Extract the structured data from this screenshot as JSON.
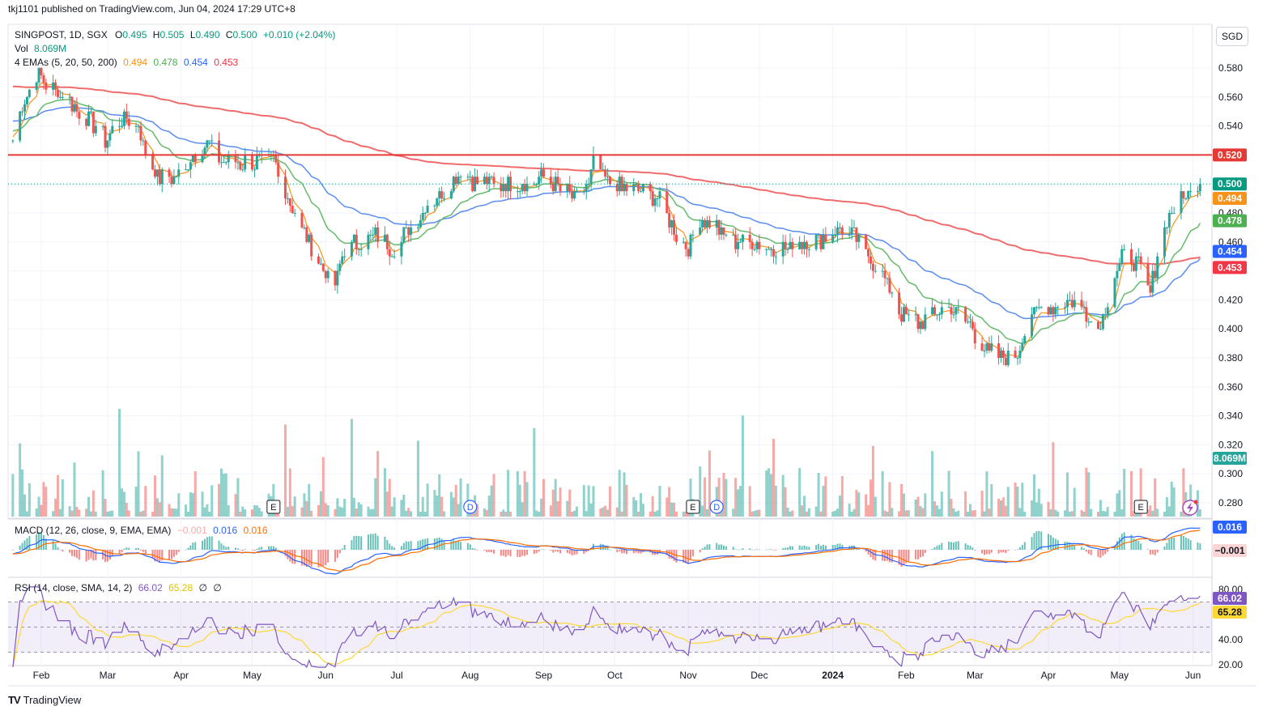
{
  "header": {
    "publish_text": "tkj1101 published on TradingView.com, Jun 04, 2024 17:29 UTC+8"
  },
  "legend": {
    "symbol": "SINGPOST, 1D, SGX",
    "o_label": "O",
    "o": "0.495",
    "h_label": "H",
    "h": "0.505",
    "l_label": "L",
    "l": "0.490",
    "c_label": "C",
    "c": "0.500",
    "change": "+0.010 (+2.04%)",
    "vol_label": "Vol",
    "vol": "8.069M",
    "ema_label": "4 EMAs (5, 20, 50, 200)",
    "ema5": "0.494",
    "ema20": "0.478",
    "ema50": "0.454",
    "ema200": "0.453"
  },
  "macd_legend": {
    "label": "MACD (12, 26, close, 9, EMA, EMA)",
    "hist": "−0.001",
    "macd": "0.016",
    "signal": "0.016"
  },
  "rsi_legend": {
    "label": "RSI (14, close, SMA, 14, 2)",
    "rsi": "66.02",
    "sma": "65.28",
    "u1": "∅",
    "u2": "∅"
  },
  "currency_button": "SGD",
  "brand": {
    "text": "TradingView",
    "logo": "TV"
  },
  "colors": {
    "up": "#26a69a",
    "down": "#ef5350",
    "ema5": "#f7931a",
    "ema20": "#66bb6a",
    "ema50": "#5b8def",
    "ema200": "#f06b6b",
    "resistance": "#e53935",
    "macd": "#2962ff",
    "signal": "#ff6d00",
    "rsi": "#7e57c2",
    "rsi_sma": "#fdd835"
  },
  "price_labels": {
    "resistance": "0.520",
    "last": "0.500",
    "ema5": "0.494",
    "ema20": "0.478",
    "ema50": "0.454",
    "ema200": "0.453",
    "volume": "8.069M",
    "macd": "0.016",
    "macd_hist": "−0.001",
    "rsi": "66.02",
    "rsi_sma": "65.28"
  },
  "event_markers": [
    {
      "label": "E",
      "kind": "earnings",
      "date": "2023-05-10"
    },
    {
      "label": "D",
      "kind": "dividend",
      "date": "2023-08-01"
    },
    {
      "label": "E",
      "kind": "earnings",
      "date": "2023-11-03"
    },
    {
      "label": "D",
      "kind": "dividend",
      "date": "2023-11-13"
    },
    {
      "label": "E",
      "kind": "earnings",
      "date": "2024-05-10"
    }
  ],
  "chart_data": {
    "type": "candlestick",
    "x_axis": {
      "labels": [
        "Feb",
        "Mar",
        "Apr",
        "May",
        "Jun",
        "Jul",
        "Aug",
        "Sep",
        "Oct",
        "Nov",
        "Dec",
        "2024",
        "Feb",
        "Mar",
        "Apr",
        "May",
        "Jun"
      ],
      "dates": [
        "2023-02-01",
        "2023-03-01",
        "2023-04-01",
        "2023-05-01",
        "2023-06-01",
        "2023-07-01",
        "2023-08-01",
        "2023-09-01",
        "2023-10-01",
        "2023-11-01",
        "2023-12-01",
        "2024-01-01",
        "2024-02-01",
        "2024-03-01",
        "2024-04-01",
        "2024-05-01",
        "2024-06-01"
      ]
    },
    "y_axis": {
      "ticks": [
        "0.580",
        "0.560",
        "0.540",
        "0.520",
        "0.500",
        "0.480",
        "0.460",
        "0.440",
        "0.420",
        "0.400",
        "0.380",
        "0.360",
        "0.340",
        "0.320",
        "0.300",
        "0.280"
      ],
      "range": [
        0.27,
        0.59
      ]
    },
    "resistance_level": 0.52,
    "last_price": 0.5,
    "close_points": [
      [
        "2023-01-20",
        0.53
      ],
      [
        "2023-01-25",
        0.56
      ],
      [
        "2023-01-30",
        0.575
      ],
      [
        "2023-02-07",
        0.565
      ],
      [
        "2023-02-14",
        0.555
      ],
      [
        "2023-02-21",
        0.545
      ],
      [
        "2023-02-28",
        0.53
      ],
      [
        "2023-03-07",
        0.545
      ],
      [
        "2023-03-14",
        0.54
      ],
      [
        "2023-03-17",
        0.52
      ],
      [
        "2023-03-22",
        0.505
      ],
      [
        "2023-03-28",
        0.505
      ],
      [
        "2023-04-03",
        0.51
      ],
      [
        "2023-04-06",
        0.52
      ],
      [
        "2023-04-12",
        0.53
      ],
      [
        "2023-04-19",
        0.515
      ],
      [
        "2023-04-26",
        0.515
      ],
      [
        "2023-05-03",
        0.515
      ],
      [
        "2023-05-10",
        0.515
      ],
      [
        "2023-05-16",
        0.49
      ],
      [
        "2023-05-22",
        0.47
      ],
      [
        "2023-05-29",
        0.445
      ],
      [
        "2023-06-05",
        0.43
      ],
      [
        "2023-06-09",
        0.455
      ],
      [
        "2023-06-16",
        0.46
      ],
      [
        "2023-06-23",
        0.465
      ],
      [
        "2023-06-30",
        0.455
      ],
      [
        "2023-07-07",
        0.47
      ],
      [
        "2023-07-14",
        0.485
      ],
      [
        "2023-07-21",
        0.495
      ],
      [
        "2023-07-28",
        0.51
      ],
      [
        "2023-08-04",
        0.5
      ],
      [
        "2023-08-11",
        0.5
      ],
      [
        "2023-08-18",
        0.5
      ],
      [
        "2023-08-25",
        0.5
      ],
      [
        "2023-09-01",
        0.505
      ],
      [
        "2023-09-08",
        0.495
      ],
      [
        "2023-09-15",
        0.49
      ],
      [
        "2023-09-20",
        0.5
      ],
      [
        "2023-09-22",
        0.515
      ],
      [
        "2023-09-29",
        0.5
      ],
      [
        "2023-10-06",
        0.495
      ],
      [
        "2023-10-13",
        0.495
      ],
      [
        "2023-10-20",
        0.49
      ],
      [
        "2023-10-27",
        0.465
      ],
      [
        "2023-11-01",
        0.455
      ],
      [
        "2023-11-06",
        0.475
      ],
      [
        "2023-11-13",
        0.47
      ],
      [
        "2023-11-20",
        0.46
      ],
      [
        "2023-11-27",
        0.46
      ],
      [
        "2023-12-04",
        0.455
      ],
      [
        "2023-12-11",
        0.455
      ],
      [
        "2023-12-18",
        0.46
      ],
      [
        "2023-12-25",
        0.46
      ],
      [
        "2024-01-02",
        0.47
      ],
      [
        "2024-01-09",
        0.465
      ],
      [
        "2024-01-16",
        0.45
      ],
      [
        "2024-01-23",
        0.435
      ],
      [
        "2024-01-30",
        0.41
      ],
      [
        "2024-02-06",
        0.405
      ],
      [
        "2024-02-13",
        0.41
      ],
      [
        "2024-02-20",
        0.415
      ],
      [
        "2024-02-27",
        0.405
      ],
      [
        "2024-03-05",
        0.385
      ],
      [
        "2024-03-12",
        0.38
      ],
      [
        "2024-03-19",
        0.385
      ],
      [
        "2024-03-25",
        0.41
      ],
      [
        "2024-04-01",
        0.415
      ],
      [
        "2024-04-08",
        0.42
      ],
      [
        "2024-04-15",
        0.415
      ],
      [
        "2024-04-22",
        0.4
      ],
      [
        "2024-04-26",
        0.42
      ],
      [
        "2024-05-02",
        0.45
      ],
      [
        "2024-05-09",
        0.445
      ],
      [
        "2024-05-14",
        0.425
      ],
      [
        "2024-05-17",
        0.45
      ],
      [
        "2024-05-22",
        0.48
      ],
      [
        "2024-05-27",
        0.49
      ],
      [
        "2024-05-31",
        0.495
      ],
      [
        "2024-06-04",
        0.5
      ]
    ],
    "series": [
      {
        "name": "EMA 5",
        "last": 0.494
      },
      {
        "name": "EMA 20",
        "last": 0.478
      },
      {
        "name": "EMA 50",
        "last": 0.454
      },
      {
        "name": "EMA 200",
        "last": 0.453
      }
    ],
    "volume": {
      "last": "8.069M"
    },
    "macd": {
      "params": "12, 26, close, 9, EMA, EMA",
      "macd_last": 0.016,
      "signal_last": 0.016,
      "hist_last": -0.001
    },
    "rsi": {
      "params": "14, close, SMA, 14, 2",
      "rsi_last": 66.02,
      "sma_last": 65.28,
      "ticks": [
        "80.00",
        "60.00",
        "40.00",
        "20.00"
      ],
      "bands": [
        70,
        50,
        30
      ]
    }
  }
}
